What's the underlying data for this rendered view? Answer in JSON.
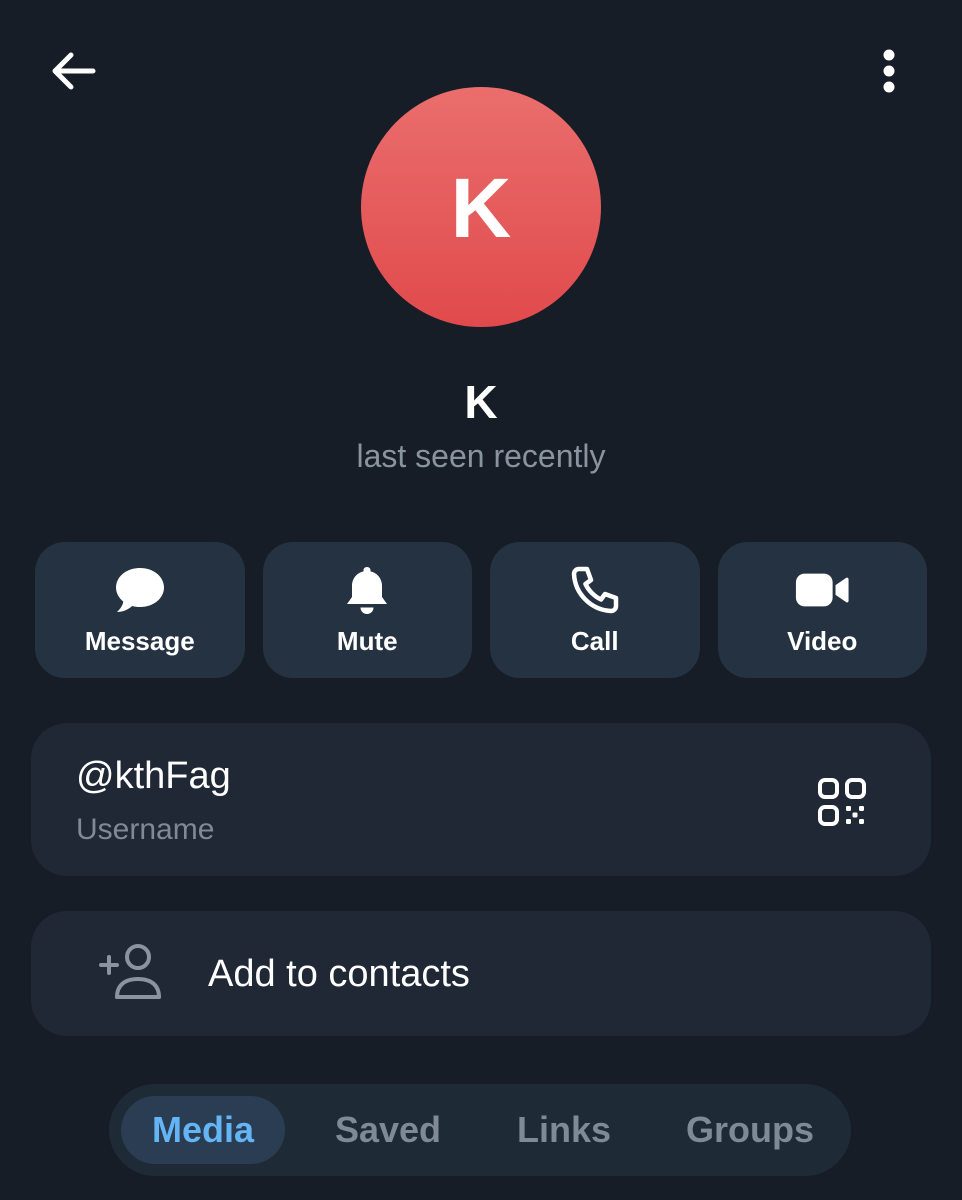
{
  "header": {
    "back_icon": "arrow-left-icon",
    "menu_icon": "more-vertical-icon"
  },
  "profile": {
    "avatar_letter": "K",
    "avatar_color": "#e5585a",
    "name": "K",
    "status": "last seen recently"
  },
  "actions": [
    {
      "label": "Message",
      "icon": "chat-bubble-icon"
    },
    {
      "label": "Mute",
      "icon": "bell-icon"
    },
    {
      "label": "Call",
      "icon": "phone-icon"
    },
    {
      "label": "Video",
      "icon": "video-camera-icon"
    }
  ],
  "username_card": {
    "value": "@kthFag",
    "caption": "Username",
    "icon": "qr-code-icon"
  },
  "contacts_card": {
    "label": "Add to contacts",
    "icon": "add-user-icon"
  },
  "tabs": [
    {
      "label": "Media",
      "active": true
    },
    {
      "label": "Saved",
      "active": false
    },
    {
      "label": "Links",
      "active": false
    },
    {
      "label": "Groups",
      "active": false
    }
  ],
  "colors": {
    "background": "#171d26",
    "button_bg": "#253241",
    "card_bg": "#1f2834",
    "accent": "#64b5f6",
    "muted_text": "#8a949f"
  }
}
